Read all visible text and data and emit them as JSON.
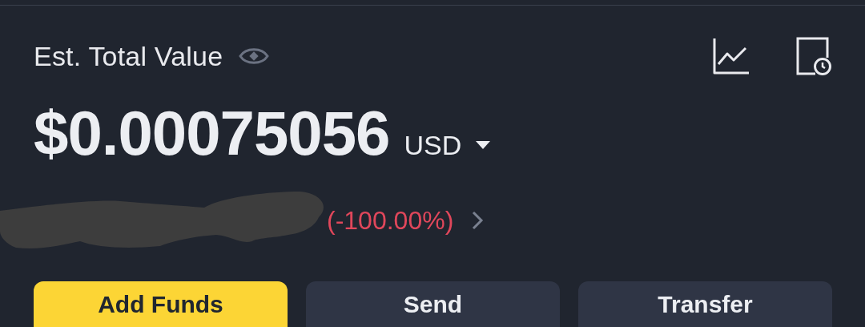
{
  "header": {
    "label": "Est. Total Value"
  },
  "balance": {
    "amount": "$0.00075056",
    "currency": "USD"
  },
  "change": {
    "percent": "(-100.00%)"
  },
  "actions": [
    {
      "label": "Add Funds",
      "primary": true
    },
    {
      "label": "Send",
      "primary": false
    },
    {
      "label": "Transfer",
      "primary": false
    }
  ]
}
